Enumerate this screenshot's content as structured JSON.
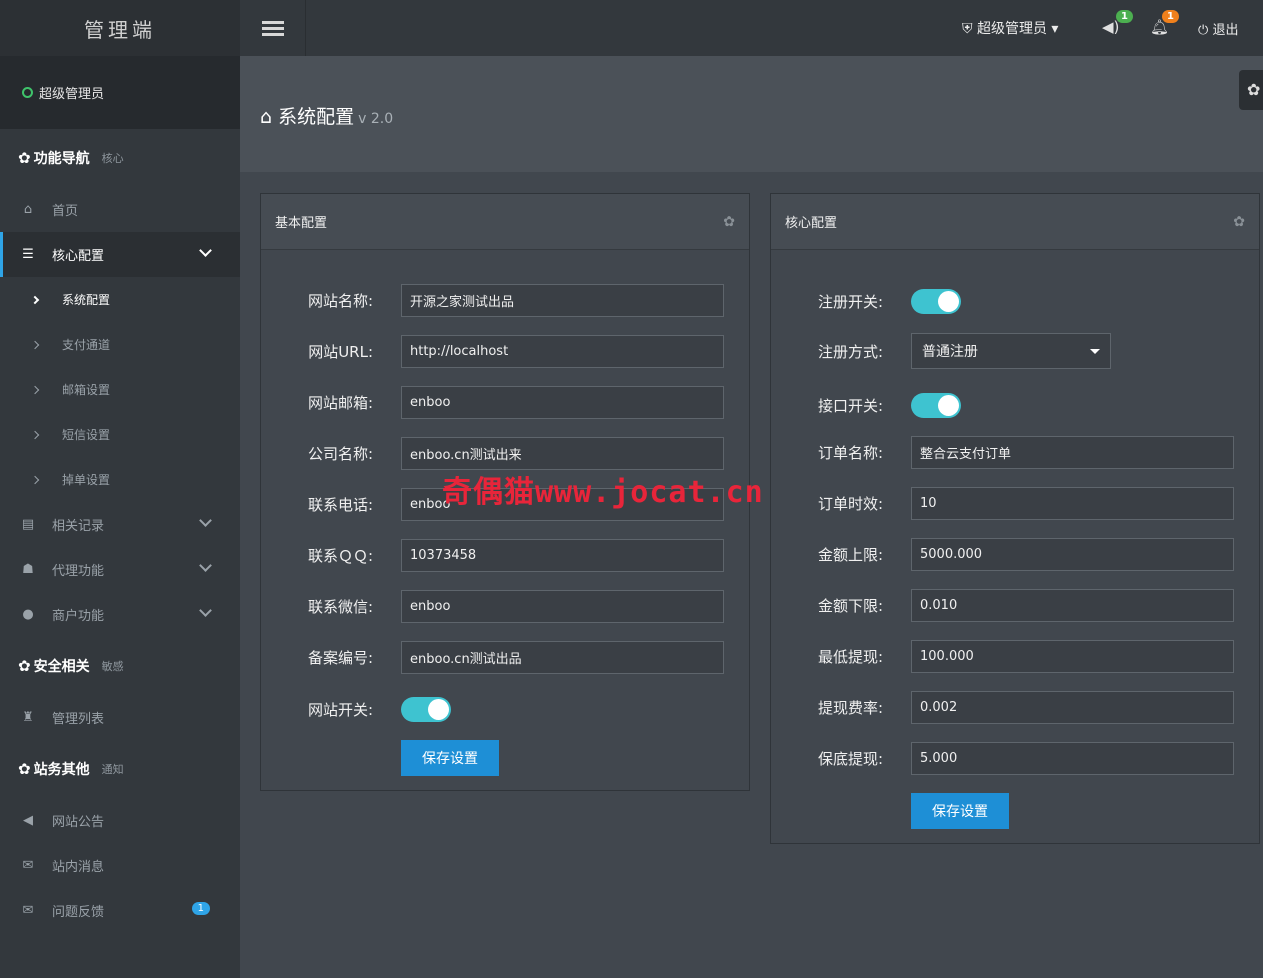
{
  "brand": "管理端",
  "user": {
    "name": "超级管理员"
  },
  "sidebar": {
    "sections": [
      {
        "title": "功能导航",
        "tag": "核心"
      },
      {
        "title": "安全相关",
        "tag": "敏感"
      },
      {
        "title": "站务其他",
        "tag": "通知"
      }
    ],
    "items": [
      {
        "label": "首页",
        "icon": "home-icon"
      },
      {
        "label": "核心配置",
        "icon": "sliders-icon"
      },
      {
        "label": "相关记录",
        "icon": "calendar-icon"
      },
      {
        "label": "代理功能",
        "icon": "users-icon"
      },
      {
        "label": "商户功能",
        "icon": "user-icon"
      },
      {
        "label": "管理列表",
        "icon": "user-secret-icon"
      },
      {
        "label": "网站公告",
        "icon": "volume-icon"
      },
      {
        "label": "站内消息",
        "icon": "envelope-icon"
      },
      {
        "label": "问题反馈",
        "icon": "envelope-icon",
        "badge": "1"
      }
    ],
    "sub_items": [
      "系统配置",
      "支付通道",
      "邮箱设置",
      "短信设置",
      "掉单设置"
    ]
  },
  "topbar": {
    "admin_label": "超级管理员",
    "sound_badge": "1",
    "bell_badge": "1",
    "exit_label": "退出"
  },
  "page": {
    "title": "系统配置",
    "version": "v 2.0"
  },
  "basic": {
    "title": "基本配置",
    "fields": [
      {
        "label": "网站名称:",
        "value": "开源之家测试出品"
      },
      {
        "label": "网站URL:",
        "value": "http://localhost"
      },
      {
        "label": "网站邮箱:",
        "value": "enboo"
      },
      {
        "label": "公司名称:",
        "value": "enboo.cn测试出来"
      },
      {
        "label": "联系电话:",
        "value": "enboo"
      },
      {
        "label": "联系ＱＱ:",
        "value": "10373458"
      },
      {
        "label": "联系微信:",
        "value": "enboo"
      },
      {
        "label": "备案编号:",
        "value": "enboo.cn测试出品"
      }
    ],
    "switch_label": "网站开关:",
    "switch_on": true,
    "save_label": "保存设置"
  },
  "core": {
    "title": "核心配置",
    "register_switch_label": "注册开关:",
    "register_mode_label": "注册方式:",
    "register_mode_value": "普通注册",
    "api_switch_label": "接口开关:",
    "fields": [
      {
        "label": "订单名称:",
        "value": "整合云支付订单"
      },
      {
        "label": "订单时效:",
        "value": "10"
      },
      {
        "label": "金额上限:",
        "value": "5000.000"
      },
      {
        "label": "金额下限:",
        "value": "0.010"
      },
      {
        "label": "最低提现:",
        "value": "100.000"
      },
      {
        "label": "提现费率:",
        "value": "0.002"
      },
      {
        "label": "保底提现:",
        "value": "5.000"
      }
    ],
    "save_label": "保存设置"
  },
  "watermark": "奇偶猫www.jocat.cn",
  "colors": {
    "accent": "#1e8fd6",
    "toggle": "#3ec3d0",
    "badge_green": "#4caf50",
    "badge_orange": "#f0801c"
  }
}
